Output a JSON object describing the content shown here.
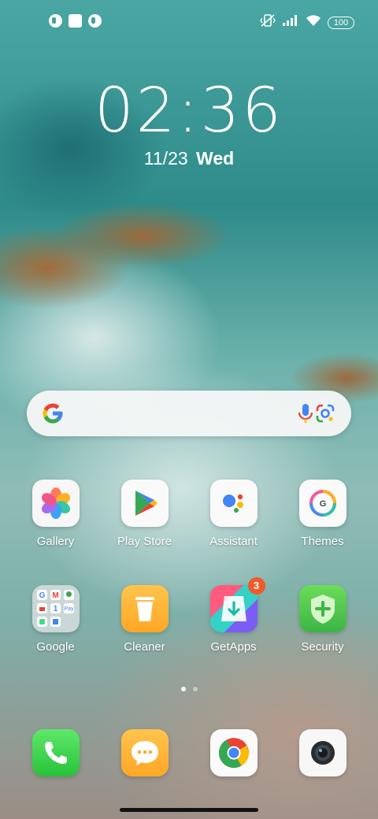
{
  "status_bar": {
    "battery": "100",
    "icons": [
      "notification-icon-1",
      "notification-icon-2",
      "notification-icon-3",
      "vibrate-mute-icon",
      "signal-icon",
      "wifi-icon",
      "battery-icon"
    ]
  },
  "lockclock": {
    "time": "02:36",
    "date_num": "11/23",
    "date_day": "Wed"
  },
  "search": {
    "icons": [
      "google-g-icon",
      "mic-icon",
      "lens-icon"
    ]
  },
  "apps_row1": [
    {
      "label": "Gallery",
      "icon": "gallery-icon"
    },
    {
      "label": "Play Store",
      "icon": "play-store-icon"
    },
    {
      "label": "Assistant",
      "icon": "assistant-icon"
    },
    {
      "label": "Themes",
      "icon": "themes-icon"
    }
  ],
  "apps_row2": [
    {
      "label": "Google",
      "icon": "google-folder-icon"
    },
    {
      "label": "Cleaner",
      "icon": "cleaner-icon"
    },
    {
      "label": "GetApps",
      "icon": "getapps-icon",
      "badge": "3"
    },
    {
      "label": "Security",
      "icon": "security-icon"
    }
  ],
  "dock": [
    {
      "icon": "phone-icon"
    },
    {
      "icon": "messaging-icon"
    },
    {
      "icon": "chrome-icon"
    },
    {
      "icon": "camera-icon"
    }
  ],
  "colors": {
    "accent_orange": "#f05a28",
    "google_blue": "#4285F4",
    "google_red": "#EA4335",
    "google_yellow": "#FBBC05",
    "google_green": "#34A853"
  }
}
